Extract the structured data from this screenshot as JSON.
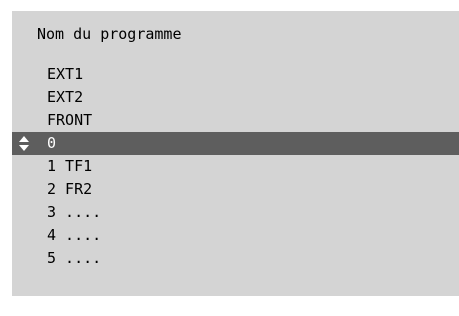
{
  "menu": {
    "title": "Nom du programme",
    "items": [
      {
        "label": "EXT1"
      },
      {
        "label": "EXT2"
      },
      {
        "label": "FRONT"
      },
      {
        "label": "0",
        "selected": true
      },
      {
        "label": "1 TF1"
      },
      {
        "label": "2 FR2"
      },
      {
        "label": "3 ...."
      },
      {
        "label": "4 ...."
      },
      {
        "label": "5 ...."
      }
    ]
  },
  "colors": {
    "panel_background": "#d4d4d4",
    "highlight_background": "#5e5e5e",
    "highlight_text": "#ffffff",
    "text": "#000000"
  },
  "icons": {
    "selection_indicator": "up-down-arrows-icon"
  }
}
